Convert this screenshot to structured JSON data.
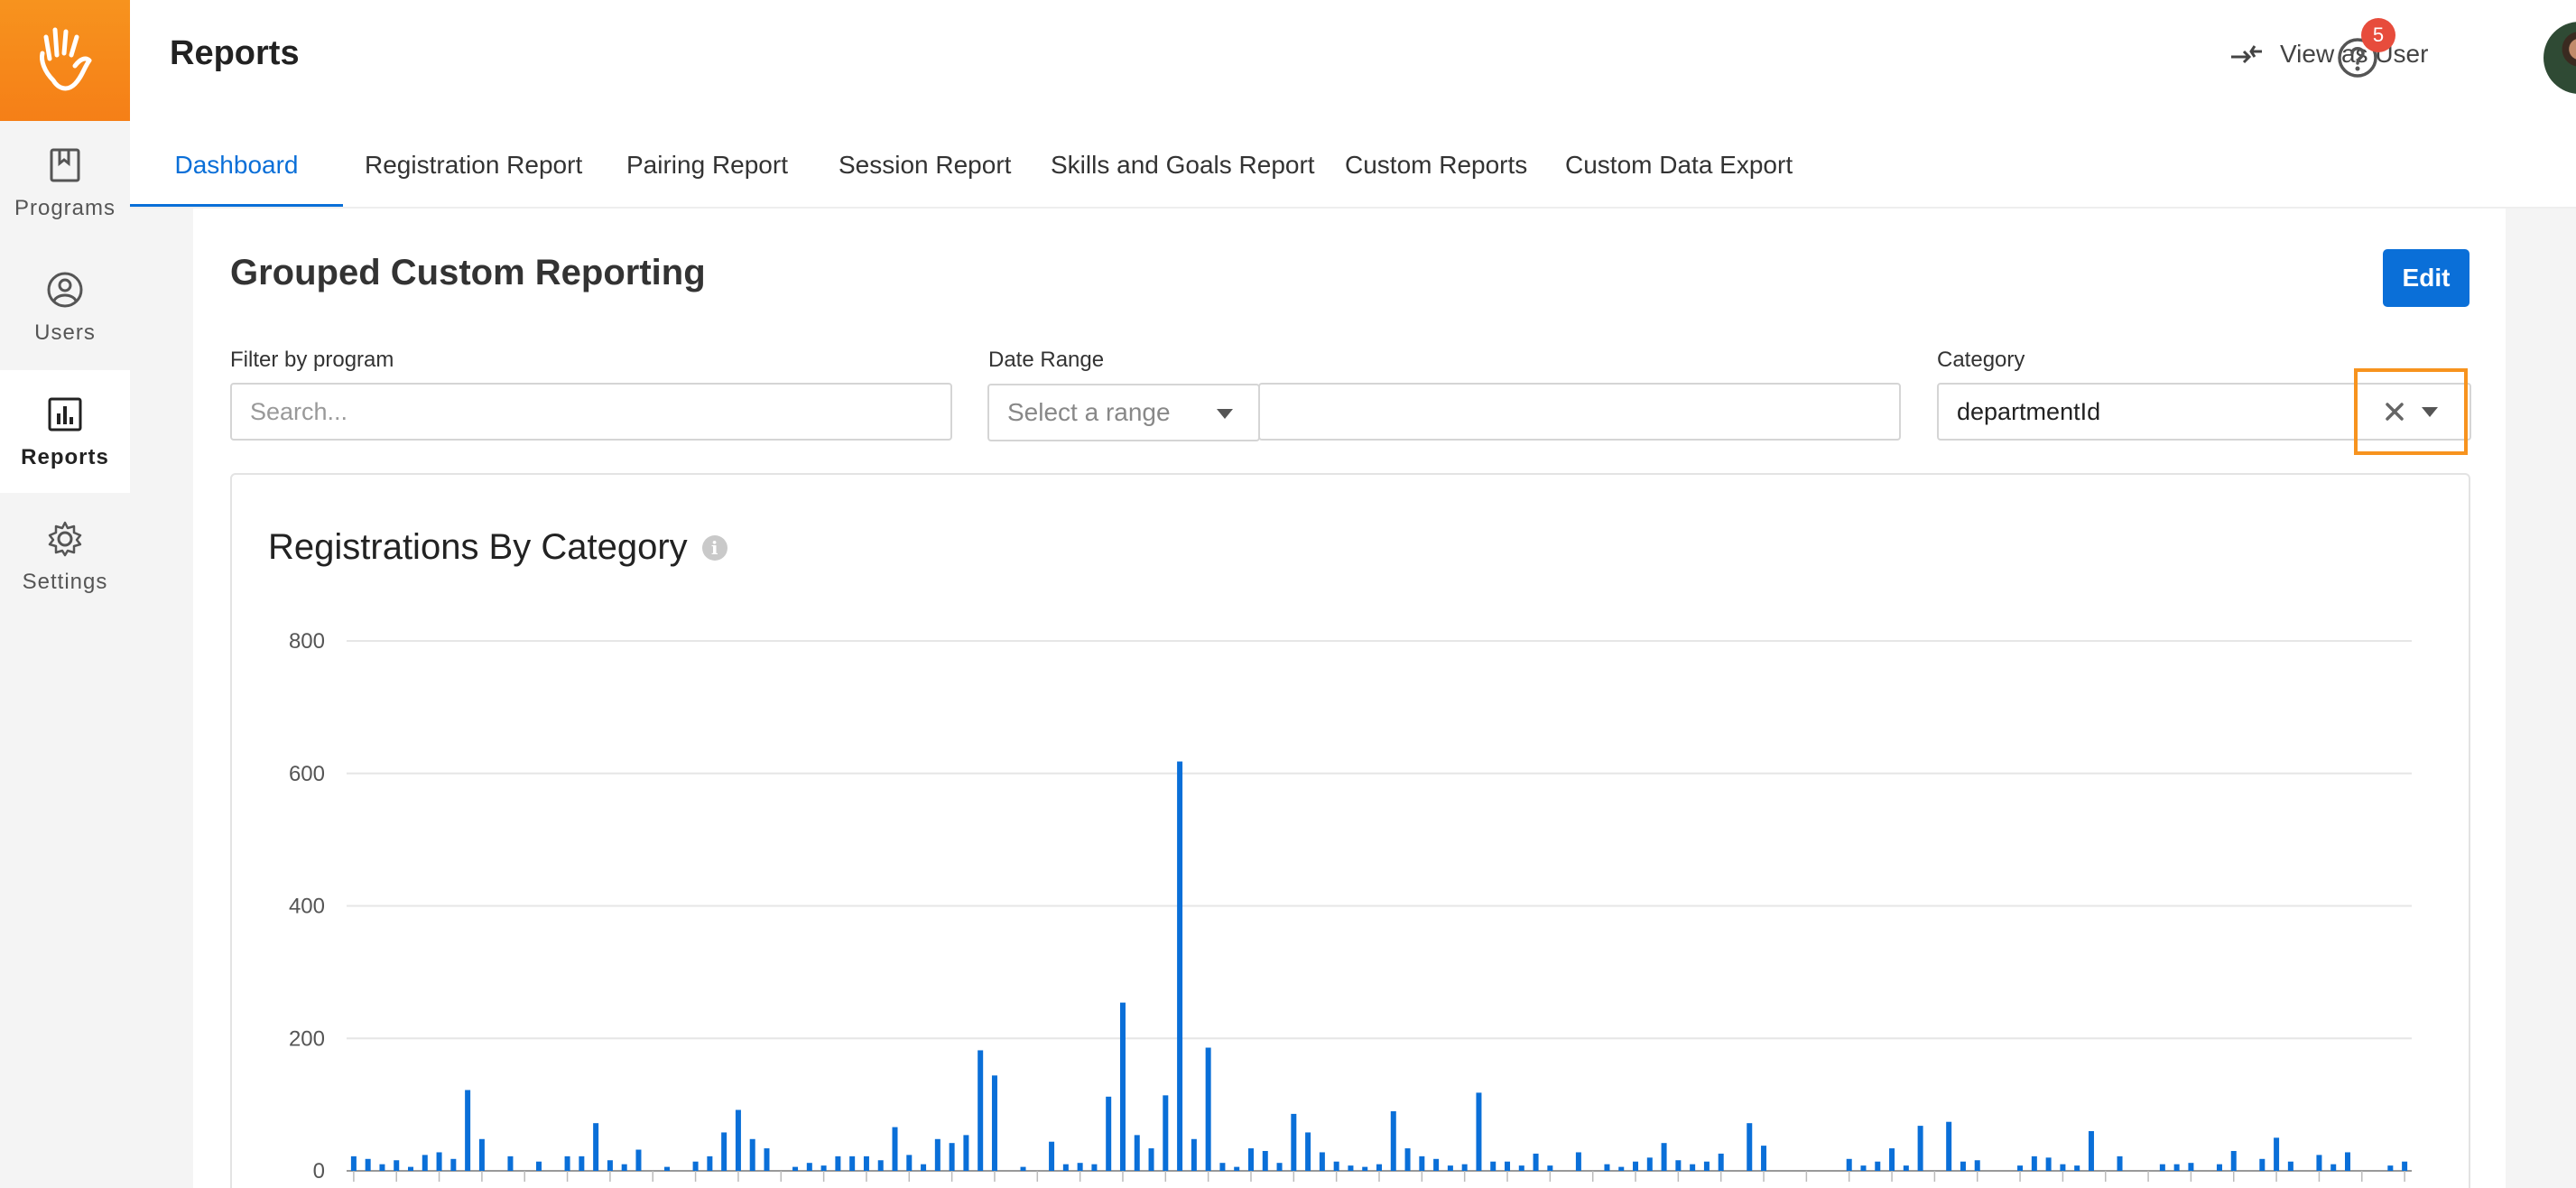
{
  "sidebar": {
    "items": [
      {
        "label": "Programs",
        "icon": "book-icon"
      },
      {
        "label": "Users",
        "icon": "user-circle-icon"
      },
      {
        "label": "Reports",
        "icon": "bar-chart-icon",
        "active": true
      },
      {
        "label": "Settings",
        "icon": "gear-icon"
      }
    ]
  },
  "header": {
    "title": "Reports",
    "view_as_user": "View as User",
    "notification_count": "5"
  },
  "tabs": [
    {
      "label": "Dashboard",
      "active": true
    },
    {
      "label": "Registration Report"
    },
    {
      "label": "Pairing Report"
    },
    {
      "label": "Session Report"
    },
    {
      "label": "Skills and Goals Report"
    },
    {
      "label": "Custom Reports"
    },
    {
      "label": "Custom Data Export"
    }
  ],
  "section": {
    "title": "Grouped Custom Reporting",
    "edit_label": "Edit"
  },
  "filters": {
    "program_label": "Filter by program",
    "program_placeholder": "Search...",
    "date_label": "Date Range",
    "date_select": "Select a range",
    "date_value": "",
    "category_label": "Category",
    "category_value": "departmentId"
  },
  "colors": {
    "accent": "#0a6fd8",
    "brand": "#f7931e",
    "bar": "#0a6fd8",
    "badge": "#e74c3c"
  },
  "chart_data": {
    "type": "bar",
    "title": "Registrations By Category",
    "xlabel": "",
    "ylabel": "",
    "ylim": [
      0,
      800
    ],
    "yticks": [
      0,
      200,
      400,
      600,
      800
    ],
    "grid": true,
    "legend": "none",
    "values": [
      22,
      18,
      10,
      16,
      6,
      24,
      28,
      18,
      122,
      48,
      0,
      22,
      0,
      14,
      0,
      22,
      22,
      72,
      16,
      10,
      32,
      0,
      6,
      0,
      14,
      22,
      58,
      92,
      48,
      34,
      0,
      6,
      12,
      8,
      22,
      22,
      22,
      16,
      66,
      24,
      10,
      48,
      42,
      54,
      182,
      144,
      0,
      6,
      0,
      44,
      10,
      12,
      10,
      112,
      254,
      54,
      34,
      114,
      618,
      48,
      186,
      12,
      6,
      34,
      30,
      12,
      86,
      58,
      28,
      14,
      8,
      6,
      10,
      90,
      34,
      22,
      18,
      8,
      10,
      118,
      14,
      14,
      8,
      26,
      8,
      0,
      28,
      0,
      10,
      6,
      14,
      20,
      42,
      16,
      10,
      14,
      26,
      0,
      72,
      38,
      0,
      0,
      0,
      0,
      0,
      18,
      8,
      14,
      34,
      8,
      68,
      0,
      74,
      14,
      16,
      0,
      0,
      8,
      22,
      20,
      10,
      8,
      60,
      0,
      22,
      0,
      0,
      10,
      10,
      12,
      0,
      10,
      30,
      0,
      18,
      50,
      14,
      0,
      24,
      10,
      28,
      0,
      0,
      8,
      14
    ]
  }
}
